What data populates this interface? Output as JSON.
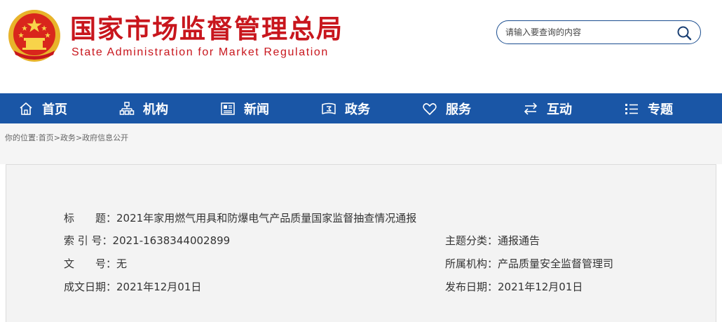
{
  "header": {
    "title_cn": "国家市场监督管理总局",
    "title_en": "State Administration for Market Regulation",
    "search_placeholder": "请输入要查询的内容"
  },
  "nav": {
    "items": [
      {
        "label": "首页",
        "icon": "home-icon"
      },
      {
        "label": "机构",
        "icon": "org-chart-icon"
      },
      {
        "label": "新闻",
        "icon": "newspaper-icon"
      },
      {
        "label": "政务",
        "icon": "government-icon"
      },
      {
        "label": "服务",
        "icon": "heart-icon"
      },
      {
        "label": "互动",
        "icon": "exchange-arrows-icon"
      },
      {
        "label": "专题",
        "icon": "topic-list-icon"
      }
    ]
  },
  "breadcrumb": {
    "prefix": "你的位置:",
    "items": [
      "首页",
      "政务",
      "政府信息公开"
    ],
    "separator": ">"
  },
  "info": {
    "title_label": "标　　题：",
    "title_value": "2021年家用燃气用具和防爆电气产品质量国家监督抽查情况通报",
    "index_label": "索 引 号：",
    "index_value": "2021-1638344002899",
    "topic_label": "主题分类：",
    "topic_value": "通报通告",
    "docno_label": "文　　号：",
    "docno_value": "无",
    "org_label": "所属机构：",
    "org_value": "产品质量安全监督管理司",
    "created_label": "成文日期：",
    "created_value": "2021年12月01日",
    "published_label": "发布日期：",
    "published_value": "2021年12月01日"
  },
  "colors": {
    "brand_red": "#c8161d",
    "nav_blue": "#1a56a6",
    "emblem_gold": "#e8b32a"
  }
}
